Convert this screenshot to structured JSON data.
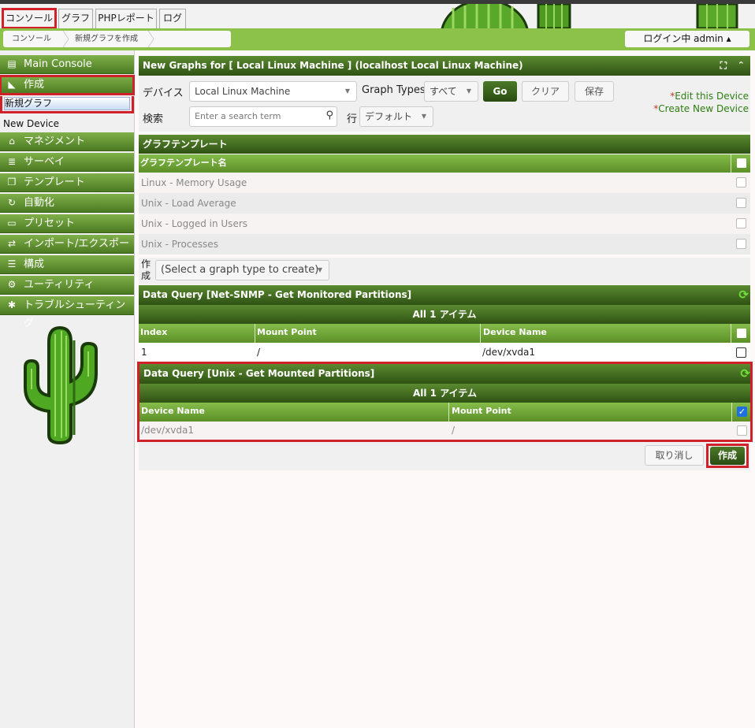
{
  "tabs": [
    {
      "label": "コンソール"
    },
    {
      "label": "グラフ"
    },
    {
      "label": "PHPレポート"
    },
    {
      "label": "ログ"
    }
  ],
  "breadcrumb": [
    "コンソール",
    "新規グラフを作成"
  ],
  "login": {
    "label": "ログイン中 admin ▴"
  },
  "sidebar": {
    "main_console": "Main Console",
    "create": "作成",
    "new_graphs": "新規グラフ",
    "new_device": "New Device",
    "items": [
      {
        "label": "マネジメント",
        "icon": "home-icon"
      },
      {
        "label": "サーベイ",
        "icon": "database-icon"
      },
      {
        "label": "テンプレート",
        "icon": "copy-icon"
      },
      {
        "label": "自動化",
        "icon": "refresh-icon"
      },
      {
        "label": "プリセット",
        "icon": "archive-icon"
      },
      {
        "label": "インポート/エクスポート",
        "icon": "exchange-icon"
      },
      {
        "label": "構成",
        "icon": "sliders-icon"
      },
      {
        "label": "ユーティリティ",
        "icon": "cogs-icon"
      },
      {
        "label": "トラブルシューティング",
        "icon": "bug-icon"
      }
    ]
  },
  "header": {
    "title": "New Graphs for [ Local Linux Machine ] (localhost Local Linux Machine)"
  },
  "filters": {
    "device_label": "デバイス",
    "device_value": "Local Linux Machine",
    "graph_types_label": "Graph Types",
    "graph_types_value": "すべて",
    "go": "Go",
    "clear": "クリア",
    "save": "保存",
    "search_label": "検索",
    "search_placeholder": "Enter a search term",
    "rows_label": "行",
    "rows_value": "デフォルト",
    "edit_device": "Edit this Device",
    "create_device": "Create New Device",
    "asterisk": "*"
  },
  "graph_templates": {
    "title": "グラフテンプレート",
    "column": "グラフテンプレート名",
    "rows": [
      "Linux - Memory Usage",
      "Unix - Load Average",
      "Unix - Logged in Users",
      "Unix - Processes"
    ],
    "create_label": "作成",
    "create_select": "(Select a graph type to create)"
  },
  "dq1": {
    "title": "Data Query [Net-SNMP - Get Monitored Partitions]",
    "items": "All 1 アイテム",
    "columns": [
      "Index",
      "Mount Point",
      "Device Name"
    ],
    "row": [
      "1",
      "/",
      "/dev/xvda1"
    ]
  },
  "dq2": {
    "title": "Data Query [Unix - Get Mounted Partitions]",
    "items": "All 1 アイテム",
    "columns": [
      "Device Name",
      "Mount Point"
    ],
    "row": [
      "/dev/xvda1",
      "/"
    ]
  },
  "actions": {
    "cancel": "取り消し",
    "create": "作成"
  },
  "colors": {
    "accent_green": "#4c7a22",
    "highlight_red": "#d0202a",
    "link_green": "#2d7d12"
  }
}
